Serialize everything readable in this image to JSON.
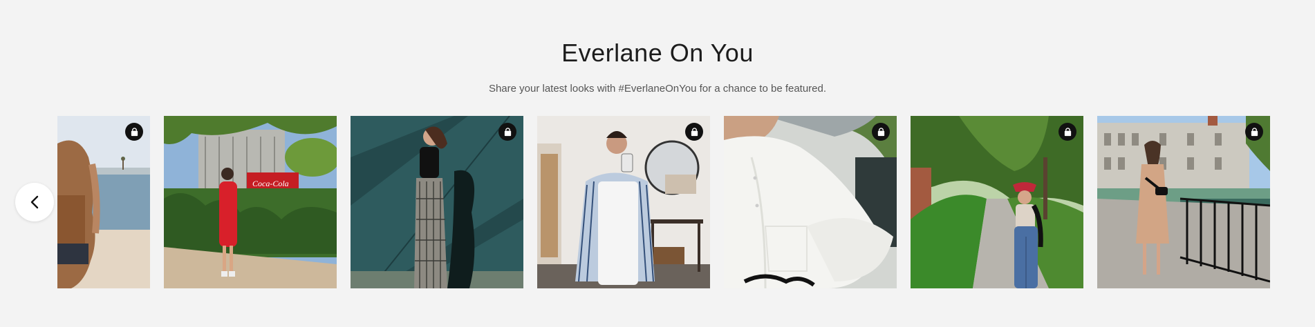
{
  "section": {
    "title": "Everlane On You",
    "subtitle": "Share your latest looks with #EverlaneOnYou for a chance to be featured."
  },
  "carousel": {
    "prev_icon": "chevron-left-icon",
    "badge_icon": "shopping-bag-icon",
    "tiles": [
      {
        "name": "beach-look",
        "partial": true
      },
      {
        "name": "red-dress-street-look"
      },
      {
        "name": "black-top-plaid-pants-look"
      },
      {
        "name": "white-overalls-mirror-selfie"
      },
      {
        "name": "white-linen-shirt-closeup"
      },
      {
        "name": "red-bucket-hat-jeans-look"
      },
      {
        "name": "tan-dress-waterfront-look"
      }
    ]
  },
  "colors": {
    "background": "#f3f3f3",
    "title": "#1c1c1c",
    "subtitle": "#555555",
    "badge": "#111111"
  }
}
